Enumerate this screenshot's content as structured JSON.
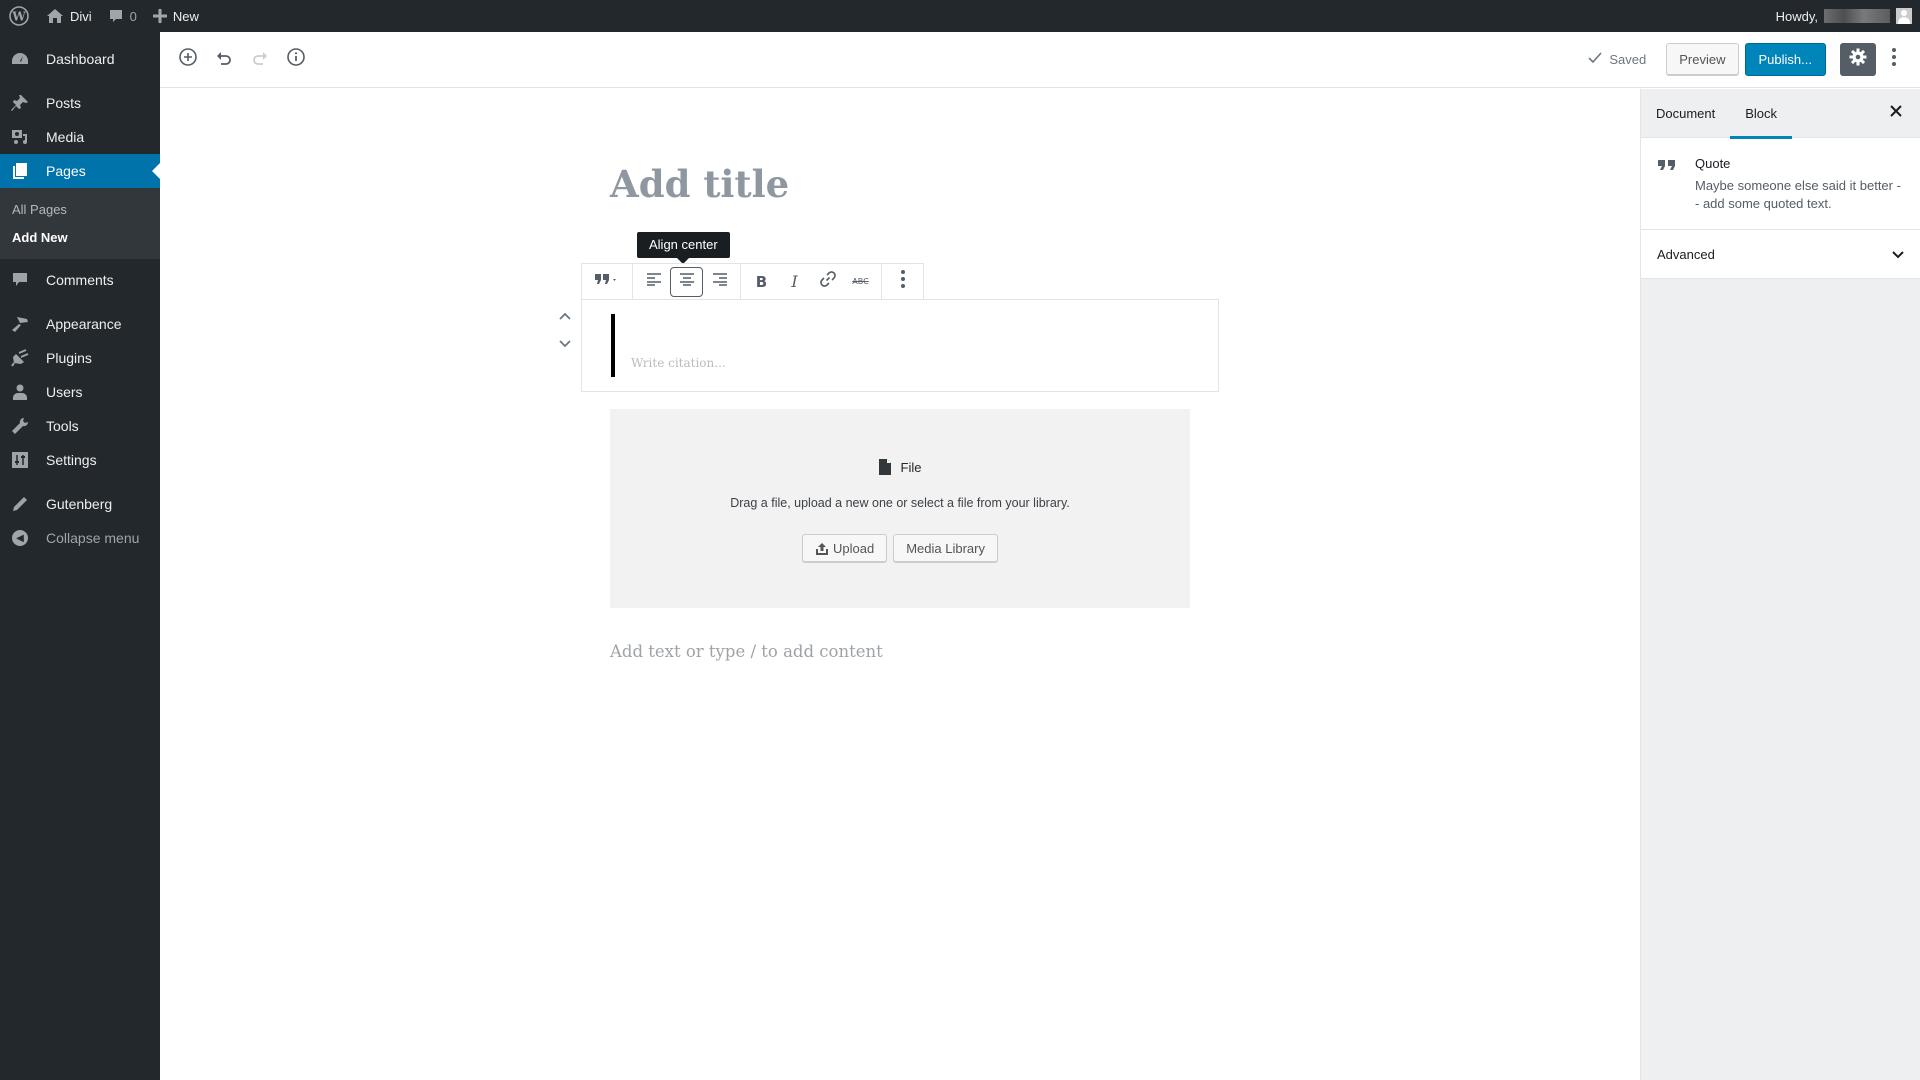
{
  "admin_bar": {
    "site_name": "Divi",
    "comments_count": "0",
    "new_label": "New",
    "howdy_label": "Howdy,"
  },
  "sidebar": {
    "items": [
      {
        "label": "Dashboard",
        "icon": "dashboard-icon"
      },
      {
        "label": "Posts",
        "icon": "pin-icon"
      },
      {
        "label": "Media",
        "icon": "media-icon"
      },
      {
        "label": "Pages",
        "icon": "pages-icon",
        "active": true
      },
      {
        "label": "Comments",
        "icon": "comment-icon"
      },
      {
        "label": "Appearance",
        "icon": "paintbrush-icon"
      },
      {
        "label": "Plugins",
        "icon": "plugin-icon"
      },
      {
        "label": "Users",
        "icon": "user-icon"
      },
      {
        "label": "Tools",
        "icon": "wrench-icon"
      },
      {
        "label": "Settings",
        "icon": "settings-icon"
      },
      {
        "label": "Gutenberg",
        "icon": "pencil-icon"
      }
    ],
    "submenu": [
      {
        "label": "All Pages"
      },
      {
        "label": "Add New",
        "current": true
      }
    ],
    "collapse_label": "Collapse menu"
  },
  "header": {
    "saved_label": "Saved",
    "preview_label": "Preview",
    "publish_label": "Publish..."
  },
  "editor": {
    "title_placeholder": "Add title",
    "tooltip": "Align center",
    "citation_placeholder": "Write citation...",
    "file_block": {
      "label": "File",
      "instructions": "Drag a file, upload a new one or select a file from your library.",
      "upload_label": "Upload",
      "media_library_label": "Media Library"
    },
    "appender_placeholder": "Add text or type / to add content"
  },
  "inspector": {
    "tabs": [
      {
        "label": "Document"
      },
      {
        "label": "Block",
        "active": true
      }
    ],
    "block": {
      "name": "Quote",
      "description": "Maybe someone else said it better -- add some quoted text."
    },
    "panels": [
      {
        "label": "Advanced"
      }
    ]
  },
  "colors": {
    "admin_bg": "#23282d",
    "accent": "#0073aa",
    "publish": "#0085ba"
  }
}
